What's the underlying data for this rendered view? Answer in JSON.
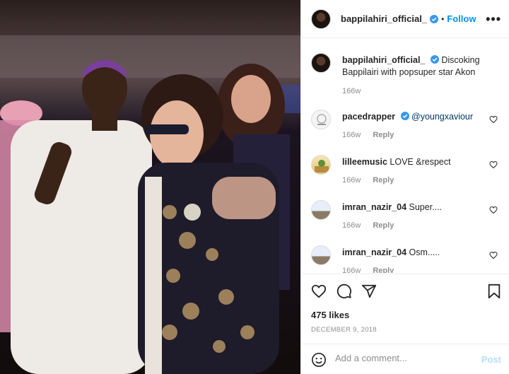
{
  "post": {
    "username": "bappilahiri_official_",
    "follow_label": "Follow",
    "separator": "•",
    "more_label": "•••",
    "caption_text": "Discoking Bappilairi with popsuper star Akon",
    "caption_age": "166w"
  },
  "comments": [
    {
      "username": "pacedrapper",
      "text": "@youngxaviour",
      "age": "166w",
      "reply": "Reply"
    },
    {
      "username": "lilleemusic",
      "text": "LOVE &respect",
      "age": "166w",
      "reply": "Reply"
    },
    {
      "username": "imran_nazir_04",
      "text": "Super....",
      "age": "166w",
      "reply": "Reply"
    },
    {
      "username": "imran_nazir_04",
      "text": "Osm.....",
      "age": "166w",
      "reply": "Reply"
    }
  ],
  "engagement": {
    "likes": "475 likes",
    "date": "DECEMBER 9, 2018"
  },
  "comment_box": {
    "placeholder": "Add a comment...",
    "post_label": "Post"
  },
  "colors": {
    "accent": "#0095f6",
    "verified": "#3897f0",
    "post_disabled": "#b2dffc",
    "muted": "#8e8e8e"
  },
  "icons": [
    "verified-badge-icon",
    "more-options-icon",
    "heart-icon",
    "comment-icon",
    "share-icon",
    "bookmark-icon",
    "emoji-icon"
  ]
}
